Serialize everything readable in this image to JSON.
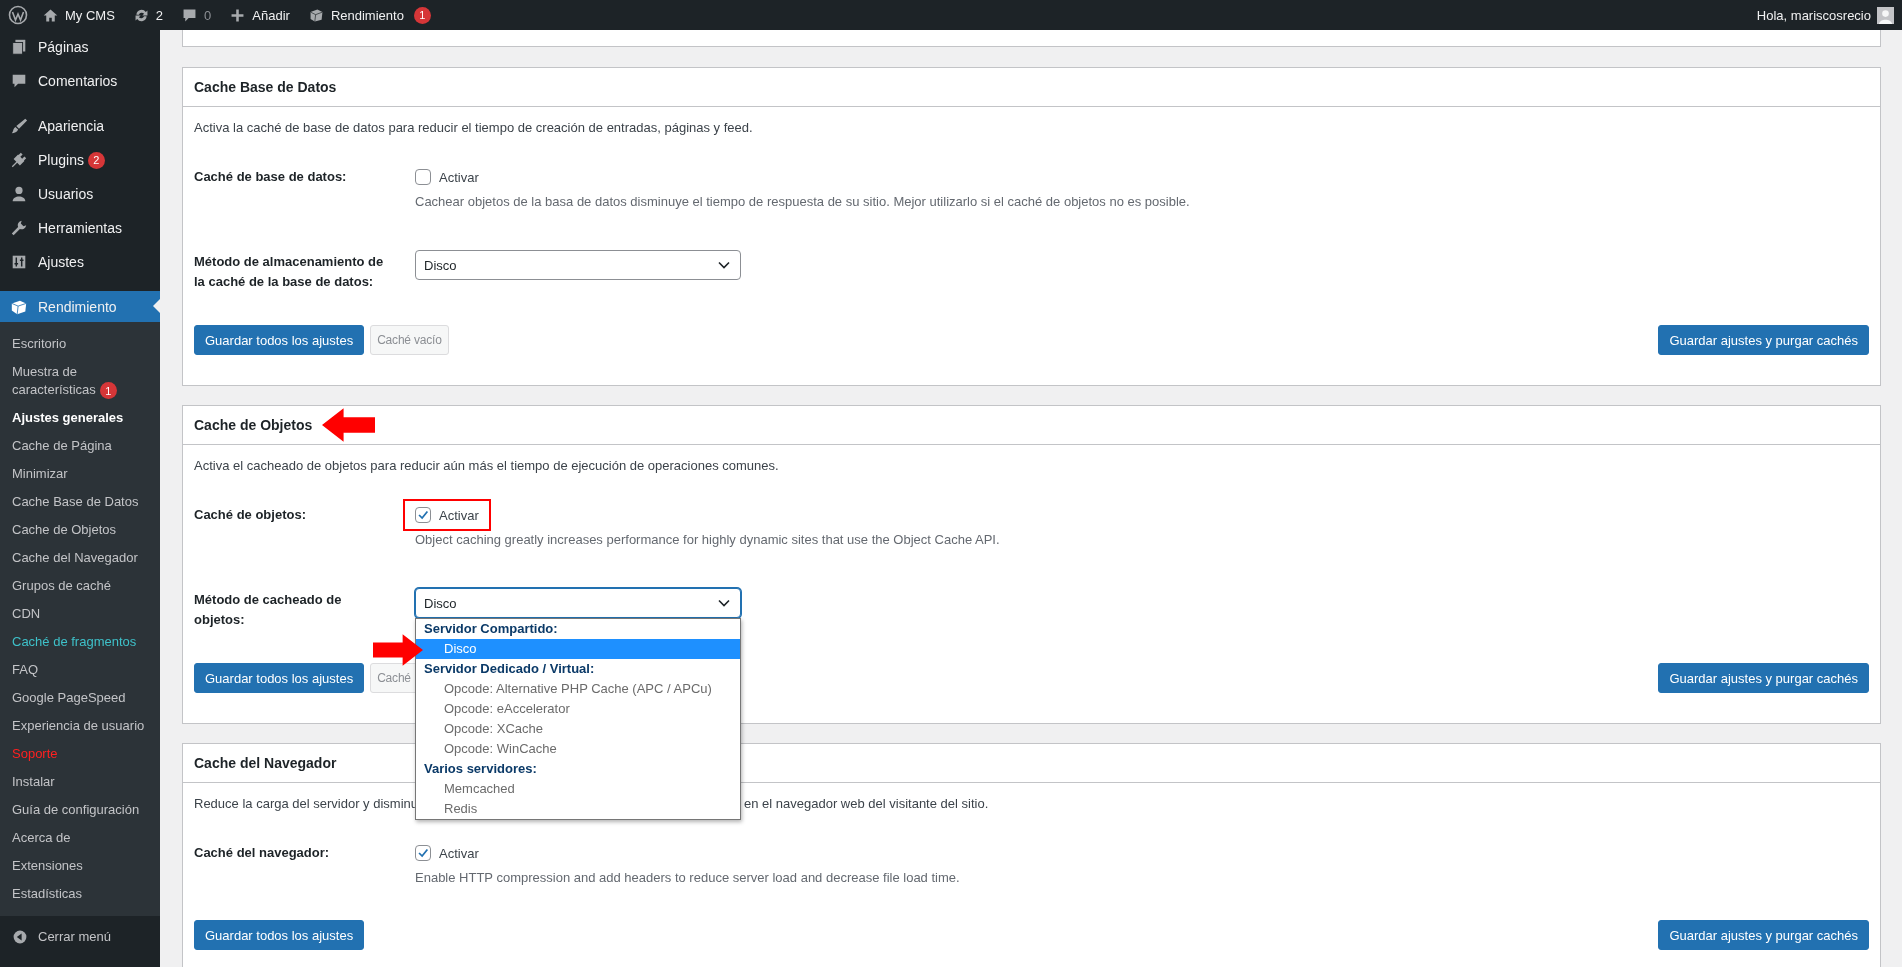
{
  "admin_bar": {
    "site": "My CMS",
    "updates": "2",
    "comments": "0",
    "new": "Añadir",
    "plugin": "Rendimiento",
    "plugin_badge": "1",
    "greeting": "Hola, mariscosrecio"
  },
  "sidebar": {
    "groups": [
      [
        {
          "label": "Páginas",
          "selected": false
        },
        {
          "label": "Comentarios",
          "selected": false
        }
      ],
      [
        {
          "label": "Apariencia",
          "selected": false
        },
        {
          "label": "Plugins",
          "badge": "2",
          "selected": false
        },
        {
          "label": "Usuarios",
          "selected": false
        },
        {
          "label": "Herramientas",
          "selected": false
        },
        {
          "label": "Ajustes",
          "selected": false
        }
      ]
    ],
    "current": {
      "label": "Rendimiento",
      "selected": true
    },
    "submenu": [
      {
        "label": "Escritorio",
        "selected": false
      },
      {
        "label": "Muestra de características",
        "badge": "1",
        "selected": false
      },
      {
        "label": "Ajustes generales",
        "selected": true
      },
      {
        "label": "Cache de Página",
        "selected": false
      },
      {
        "label": "Minimizar",
        "selected": false
      },
      {
        "label": "Cache Base de Datos",
        "selected": false
      },
      {
        "label": "Cache de Objetos",
        "selected": false
      },
      {
        "label": "Cache del Navegador",
        "selected": false
      },
      {
        "label": "Grupos de caché",
        "selected": false
      },
      {
        "label": "CDN",
        "selected": false
      },
      {
        "label": "Caché de fragmentos",
        "selected": false,
        "color": "#3ec1c9"
      },
      {
        "label": "FAQ",
        "selected": false
      },
      {
        "label": "Google PageSpeed",
        "selected": false
      },
      {
        "label": "Experiencia de usuario",
        "selected": false
      },
      {
        "label": "Soporte",
        "selected": false,
        "color": "#ff2020"
      },
      {
        "label": "Instalar",
        "selected": false
      },
      {
        "label": "Guía de configuración",
        "selected": false
      },
      {
        "label": "Acerca de",
        "selected": false
      },
      {
        "label": "Extensiones",
        "selected": false
      },
      {
        "label": "Estadísticas",
        "selected": false
      }
    ],
    "collapse": "Cerrar menú"
  },
  "panels": [
    {
      "title": "Cache Base de Datos",
      "title_arrow": false,
      "description": [
        "Activa la caché de base de datos para reducir el tiempo de creación de entradas, páginas y feed."
      ],
      "rows": [
        {
          "kind": "checkbox",
          "label": "Caché de base de datos:",
          "checked": false,
          "highlighted": false,
          "text": "Activar",
          "help": "Cachear objetos de la basa de datos disminuye el tiempo de respuesta de su sitio. Mejor utilizarlo si el caché de objetos no es posible."
        },
        {
          "kind": "select",
          "label": "Método de almacenamiento de la caché de la base de datos:",
          "value": "Disco",
          "open": false
        }
      ],
      "buttons": [
        {
          "label": "Guardar todos los ajustes",
          "kind": "primary",
          "disabled": false
        },
        {
          "label": "Caché vacío",
          "kind": "secondary",
          "disabled": true
        }
      ],
      "button_right": {
        "label": "Guardar ajustes y purgar cachés",
        "disabled": false
      }
    },
    {
      "title": "Cache de Objetos",
      "title_arrow": true,
      "description": [
        "Activa el cacheado de objetos para reducir aún más el tiempo de ejecución de operaciones comunes."
      ],
      "rows": [
        {
          "kind": "checkbox",
          "label": "Caché de objetos:",
          "checked": true,
          "highlighted": true,
          "text": "Activar",
          "help": "Object caching greatly increases performance for highly dynamic sites that use the Object Cache API."
        },
        {
          "kind": "select",
          "label": "Método de cacheado de objetos:",
          "value": "Disco",
          "open": true,
          "arrow": true,
          "options": [
            {
              "label": "Servidor Compartido:",
              "kind": "group",
              "selected": false
            },
            {
              "label": "Disco",
              "kind": "option",
              "selected": true
            },
            {
              "label": "Servidor Dedicado / Virtual:",
              "kind": "group",
              "selected": false
            },
            {
              "label": "Opcode: Alternative PHP Cache (APC / APCu)",
              "kind": "option",
              "selected": false
            },
            {
              "label": "Opcode: eAccelerator",
              "kind": "option",
              "selected": false
            },
            {
              "label": "Opcode: XCache",
              "kind": "option",
              "selected": false
            },
            {
              "label": "Opcode: WinCache",
              "kind": "option",
              "selected": false
            },
            {
              "label": "Varios servidores:",
              "kind": "group",
              "selected": false
            },
            {
              "label": "Memcached",
              "kind": "option",
              "selected": false
            },
            {
              "label": "Redis",
              "kind": "option",
              "selected": false
            }
          ]
        }
      ],
      "buttons": [
        {
          "label": "Guardar todos los ajustes",
          "kind": "primary",
          "disabled": false
        },
        {
          "label": "Caché",
          "kind": "secondary",
          "disabled": true
        }
      ],
      "button_right": {
        "label": "Guardar ajustes y purgar cachés",
        "disabled": false
      }
    },
    {
      "title": "Cache del Navegador",
      "title_arrow": false,
      "description": [
        "Reduce la carga del servidor y disminu",
        "en el navegador web del visitante del sitio."
      ],
      "rows": [
        {
          "kind": "checkbox",
          "label": "Caché del navegador:",
          "checked": true,
          "highlighted": false,
          "text": "Activar",
          "help": "Enable HTTP compression and add headers to reduce server load and decrease file load time."
        }
      ],
      "buttons": [
        {
          "label": "Guardar todos los ajustes",
          "kind": "primary",
          "disabled": false
        }
      ],
      "button_right": {
        "label": "Guardar ajustes y purgar cachés",
        "disabled": false
      }
    }
  ]
}
